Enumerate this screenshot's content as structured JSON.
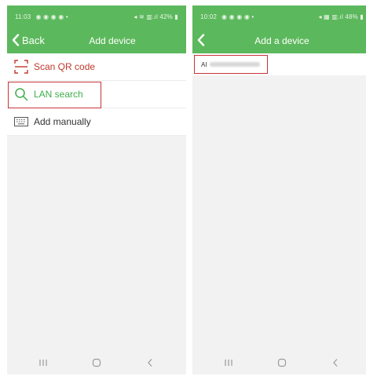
{
  "left_screen": {
    "status_bar": {
      "time": "11:03",
      "icons": "◉ ◉ ◉ ◉ •",
      "right": "◂ ≋ ▥.ıl 42% ▮"
    },
    "header": {
      "back_label": "Back",
      "title": "Add device"
    },
    "menu": {
      "items": [
        {
          "label": "Scan QR code",
          "icon": "scan-qr-icon"
        },
        {
          "label": "LAN search",
          "icon": "search-icon"
        },
        {
          "label": "Add manually",
          "icon": "keyboard-icon"
        }
      ]
    }
  },
  "right_screen": {
    "status_bar": {
      "time": "10:02",
      "icons": "◉ ◉ ◉ ◉ •",
      "right": "◂ ▦ ▥.ıl 48% ▮"
    },
    "header": {
      "title": "Add a device"
    },
    "device_list": {
      "items": [
        {
          "label_prefix": "AI"
        }
      ]
    }
  },
  "colors": {
    "header_green": "#5cb85c",
    "scan_red": "#c0392b",
    "lan_green": "#3fae49",
    "highlight_red": "#c9333a"
  }
}
